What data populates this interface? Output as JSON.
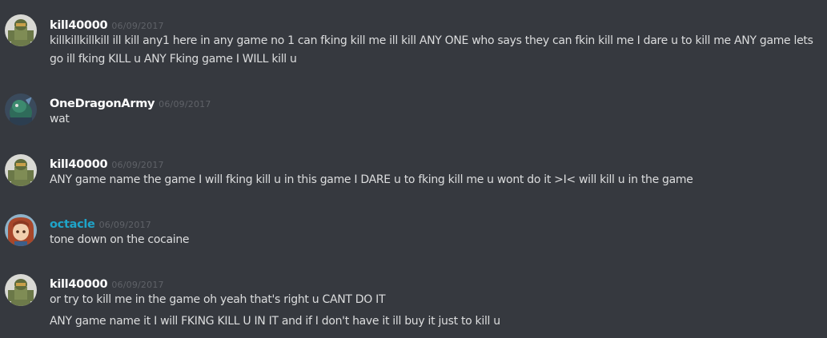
{
  "messages": [
    {
      "author": "kill40000",
      "timestamp": "06/09/2017",
      "lines": [
        "killkillkillkill ill kill any1 here in any game no 1 can fking kill me ill kill ANY ONE who says they can fkin kill me I dare u to kill me ANY game lets",
        "go ill fking KILL u ANY Fking game I WILL kill u"
      ]
    },
    {
      "author": "OneDragonArmy",
      "timestamp": "06/09/2017",
      "lines": [
        "wat"
      ]
    },
    {
      "author": "kill40000",
      "timestamp": "06/09/2017",
      "lines": [
        "ANY game name the game I will fking kill u in this game I DARE u to fking kill me u wont do it >I< will kill u in the game"
      ]
    },
    {
      "author": "octacle",
      "timestamp": "06/09/2017",
      "author_color": "#1fa4c9",
      "lines": [
        "tone down on the cocaine"
      ]
    },
    {
      "author": "kill40000",
      "timestamp": "06/09/2017",
      "lines": [
        "or try to kill me in the game oh yeah that's right u CANT DO IT",
        "ANY game name it I will FKING KILL U IN IT and if I don't have it ill buy it just to kill u"
      ]
    }
  ]
}
